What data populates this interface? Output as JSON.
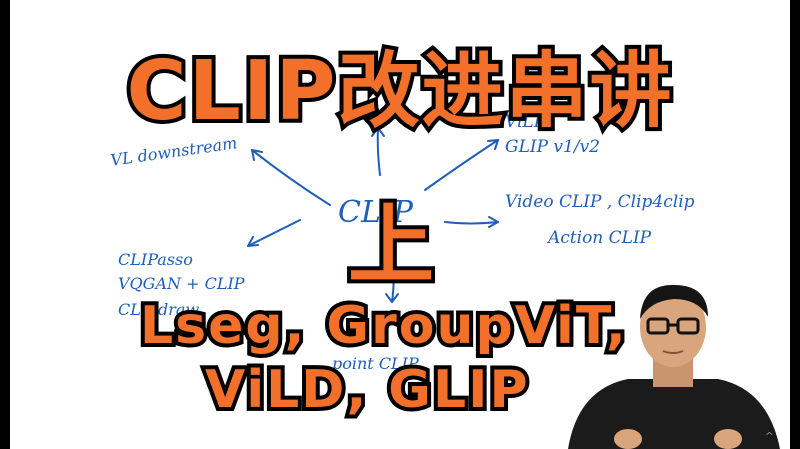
{
  "title": {
    "line1": "CLIP改进串讲",
    "line2": "上",
    "line3": "Lseg, GroupViT,",
    "line4": "ViLD, GLIP"
  },
  "sketch": {
    "center": "CLIP",
    "vl_downstream": "VL downstream",
    "vild_top": "ViLD",
    "glip": "GLIP v1/v2",
    "video": "Video CLIP , Clip4clip",
    "action": "Action CLIP",
    "clipasso": "CLIPasso",
    "vqgan": "VQGAN + CLIP",
    "clipdraw": "CLIPdraw",
    "pointclip": "point CLIP"
  },
  "colors": {
    "title_fill": "#f2702a",
    "title_stroke": "#000000",
    "ink": "#1f5fb8"
  },
  "presenter": {
    "icon": "presenter-image"
  },
  "ui": {
    "scroll_caret": "^"
  }
}
